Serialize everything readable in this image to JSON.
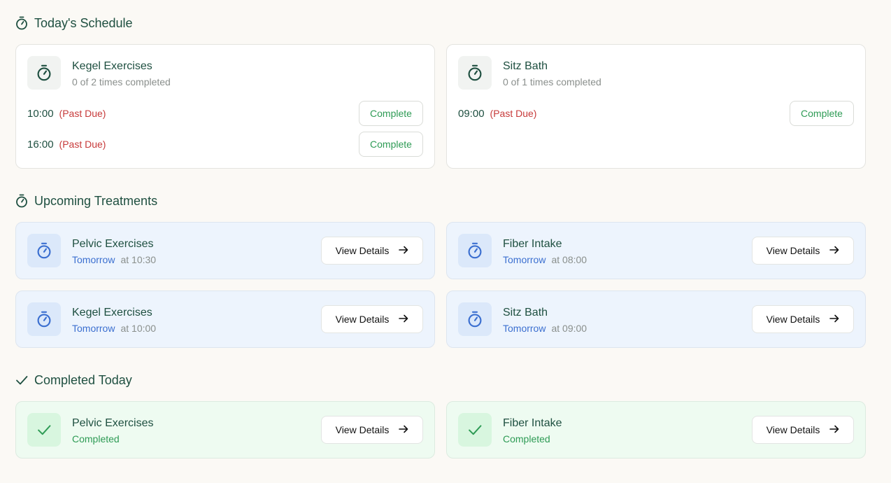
{
  "schedule": {
    "title": "Today's Schedule",
    "items": [
      {
        "name": "Kegel Exercises",
        "progress": "0 of 2 times completed",
        "slots": [
          {
            "time": "10:00",
            "status": "(Past Due)",
            "button": "Complete"
          },
          {
            "time": "16:00",
            "status": "(Past Due)",
            "button": "Complete"
          }
        ]
      },
      {
        "name": "Sitz Bath",
        "progress": "0 of 1 times completed",
        "slots": [
          {
            "time": "09:00",
            "status": "(Past Due)",
            "button": "Complete"
          }
        ]
      }
    ]
  },
  "upcoming": {
    "title": "Upcoming Treatments",
    "items": [
      {
        "name": "Pelvic Exercises",
        "day": "Tomorrow",
        "time": "at 10:30",
        "button": "View Details"
      },
      {
        "name": "Fiber Intake",
        "day": "Tomorrow",
        "time": "at 08:00",
        "button": "View Details"
      },
      {
        "name": "Kegel Exercises",
        "day": "Tomorrow",
        "time": "at 10:00",
        "button": "View Details"
      },
      {
        "name": "Sitz Bath",
        "day": "Tomorrow",
        "time": "at 09:00",
        "button": "View Details"
      }
    ]
  },
  "completed": {
    "title": "Completed Today",
    "items": [
      {
        "name": "Pelvic Exercises",
        "status": "Completed",
        "button": "View Details"
      },
      {
        "name": "Fiber Intake",
        "status": "Completed",
        "button": "View Details"
      }
    ]
  },
  "icons": {
    "section_schedule": "timer-icon",
    "section_upcoming": "timer-icon",
    "section_completed": "check-icon",
    "arrow": "arrow-right-icon"
  },
  "colors": {
    "heading": "#1e4f40",
    "past_due": "#c73a3a",
    "complete_green": "#2e9b55",
    "tomorrow_blue": "#3b6fd0",
    "blue_card": "#edf4fd",
    "green_card": "#eefbf1"
  }
}
